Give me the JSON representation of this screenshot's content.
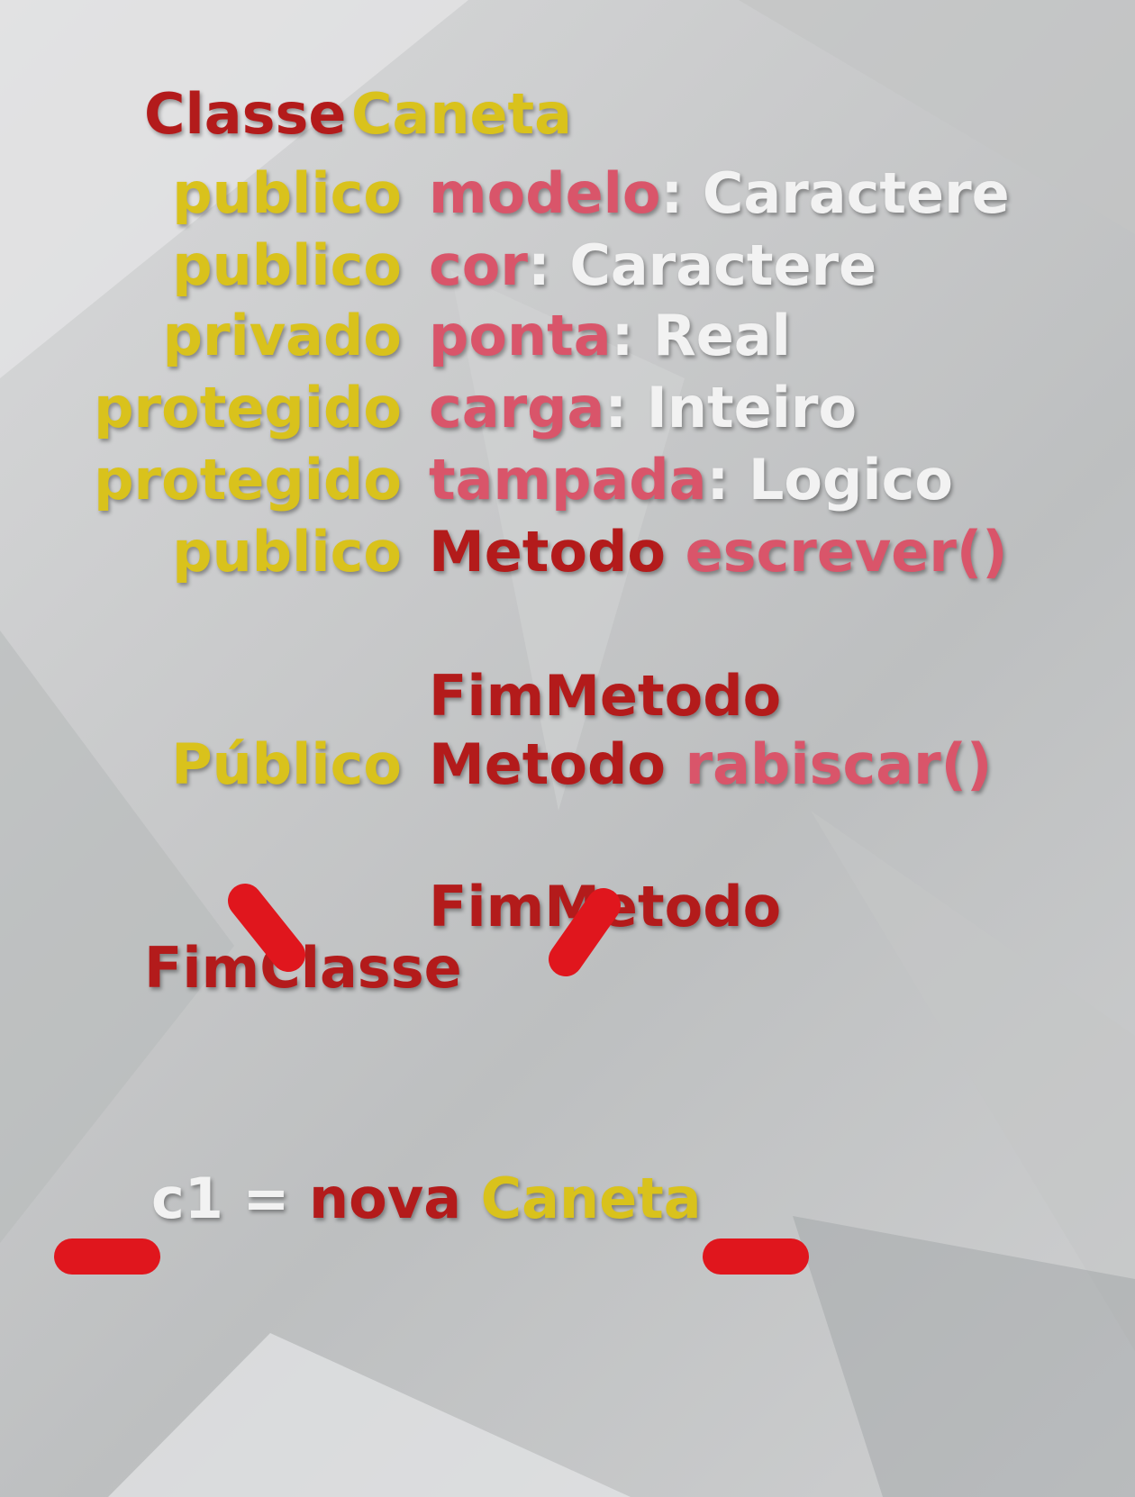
{
  "colors": {
    "keyword_red": "#b31b1b",
    "class_yellow": "#d9c21c",
    "attribute_pink": "#d9556a",
    "type_white": "#f2f2f2",
    "marker_red": "#e0161d"
  },
  "class_header": {
    "keyword": "Classe",
    "name": "Caneta"
  },
  "members": [
    {
      "visibility": "publico",
      "name": "modelo",
      "sep": ":",
      "type": "Caracter​e"
    },
    {
      "visibility": "publico",
      "name": "cor",
      "sep": ":",
      "type": "Caractere"
    },
    {
      "visibility": "privado",
      "name": "ponta",
      "sep": ":",
      "type": "Real"
    },
    {
      "visibility": "protegido",
      "name": "carga",
      "sep": ":",
      "type": "Inteiro"
    },
    {
      "visibility": "protegido",
      "name": "tampada",
      "sep": ":",
      "type": "Logico"
    }
  ],
  "methods": [
    {
      "visibility": "publico",
      "keyword": "Metodo",
      "name": "escrever()",
      "end": "FimMetodo"
    },
    {
      "visibility": "Público",
      "keyword": "Metodo",
      "name": "rabiscar()",
      "end": "FimMetodo"
    }
  ],
  "class_end": "FimClasse",
  "instantiation": {
    "var": "c1",
    "op": "=",
    "keyword": "nova",
    "class": "Caneta"
  }
}
